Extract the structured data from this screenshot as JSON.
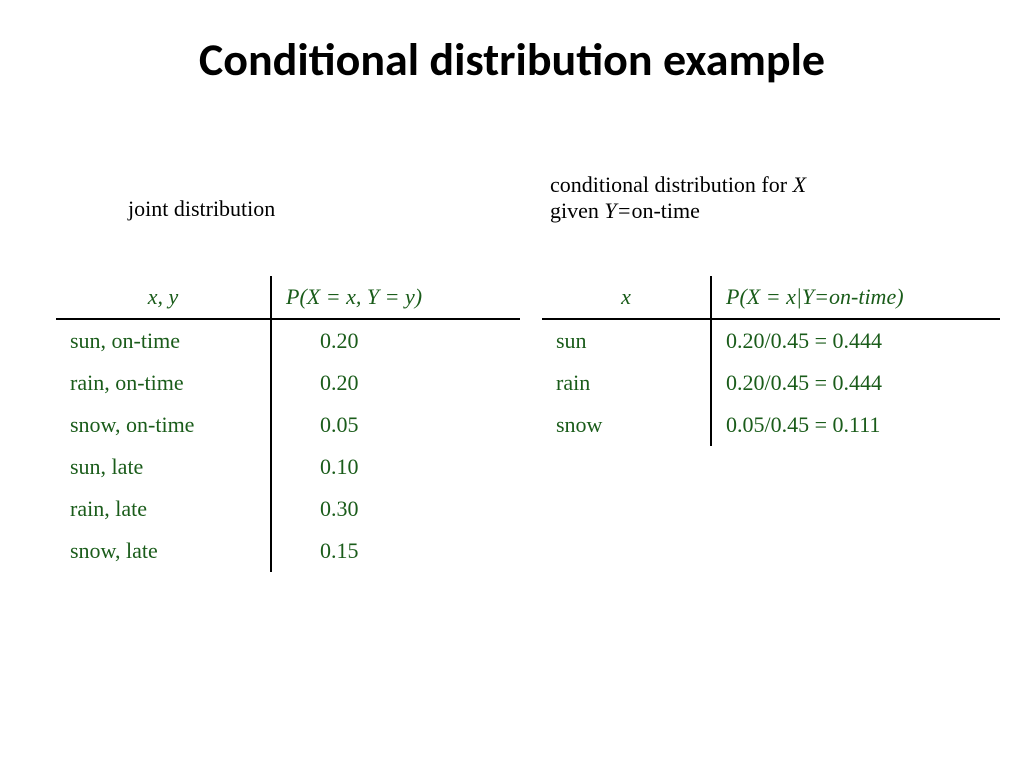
{
  "title": "Conditional distribution example",
  "left": {
    "caption": "joint distribution",
    "head_left_html": "<span style=\"font-style:italic\">x</span>, <span style=\"font-style:italic\">y</span>",
    "head_right_html": "<span style=\"font-style:italic\">P</span>(<span style=\"font-style:italic\">X</span> = <span style=\"font-style:italic\">x</span>, <span style=\"font-style:italic\">Y</span> = <span style=\"font-style:italic\">y</span>)",
    "rows": [
      {
        "label": "sun, on-time",
        "value": "0.20"
      },
      {
        "label": "rain, on-time",
        "value": "0.20"
      },
      {
        "label": "snow, on-time",
        "value": "0.05"
      },
      {
        "label": "sun, late",
        "value": "0.10"
      },
      {
        "label": "rain, late",
        "value": "0.30"
      },
      {
        "label": "snow, late",
        "value": "0.15"
      }
    ]
  },
  "right": {
    "caption_html": "conditional distribution for <span class=\"it\">X</span><br>given <span class=\"it\">Y=</span>on-time",
    "head_left_html": "<span style=\"font-style:italic\">x</span>",
    "head_right_html": "<span style=\"font-style:italic\">P</span>(<span style=\"font-style:italic\">X</span> = <span style=\"font-style:italic\">x</span>|<span style=\"font-style:italic\">Y=on-time</span>)",
    "rows": [
      {
        "label": "sun",
        "value": "0.20/0.45 = 0.444"
      },
      {
        "label": "rain",
        "value": "0.20/0.45 = 0.444"
      },
      {
        "label": "snow",
        "value": "0.05/0.45 = 0.111"
      }
    ]
  },
  "chart_data": {
    "type": "table",
    "joint_distribution": {
      "x_values": [
        "sun",
        "rain",
        "snow"
      ],
      "y_values": [
        "on-time",
        "late"
      ],
      "P": [
        [
          "sun",
          "on-time",
          0.2
        ],
        [
          "rain",
          "on-time",
          0.2
        ],
        [
          "snow",
          "on-time",
          0.05
        ],
        [
          "sun",
          "late",
          0.1
        ],
        [
          "rain",
          "late",
          0.3
        ],
        [
          "snow",
          "late",
          0.15
        ]
      ]
    },
    "conditional_given_Y_on_time": {
      "sun": 0.444,
      "rain": 0.444,
      "snow": 0.111
    }
  }
}
